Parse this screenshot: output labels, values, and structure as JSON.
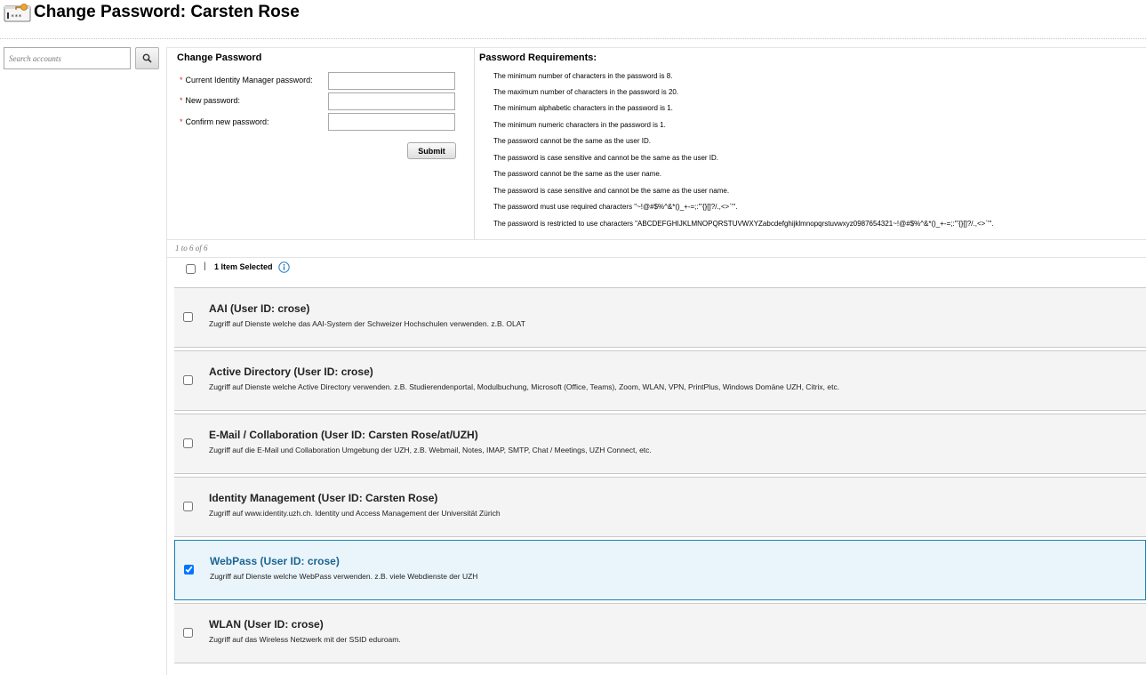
{
  "header": {
    "title": "Change Password: Carsten Rose",
    "icon_name": "password-key-icon"
  },
  "search": {
    "placeholder": "Search accounts",
    "icon_name": "magnifier-icon"
  },
  "change_password": {
    "title": "Change Password",
    "required_marker": "*",
    "fields": [
      {
        "label": "Current Identity Manager password:",
        "value": ""
      },
      {
        "label": "New password:",
        "value": ""
      },
      {
        "label": "Confirm new password:",
        "value": ""
      }
    ],
    "submit_label": "Submit"
  },
  "requirements": {
    "title": "Password Requirements:",
    "items": [
      "The minimum number of characters in the password is 8.",
      "The maximum number of characters in the password is 20.",
      "The minimum alphabetic characters in the password is 1.",
      "The minimum numeric characters in the password is 1.",
      "The password cannot be the same as the user ID.",
      "The password is case sensitive and cannot be the same as the user ID.",
      "The password cannot be the same as the user name.",
      "The password is case sensitive and cannot be the same as the user name.",
      "The password must use required characters \"~!@#$%^&*()_+-=;:'\"{}[]?/.,<>`'\".",
      "The password is restricted to use characters \"ABCDEFGHIJKLMNOPQRSTUVWXYZabcdefghijklmnopqrstuvwxyz0987654321~!@#$%^&*()_+-=;:'\"{}[]?/.,<>`'\"."
    ]
  },
  "results": {
    "count_text": "1 to 6 of 6",
    "separator": "|",
    "selected_text": "1 Item Selected"
  },
  "accounts": [
    {
      "title": "AAI (User ID: crose)",
      "description": "Zugriff auf Dienste welche das AAI-System der Schweizer Hochschulen verwenden. z.B. OLAT",
      "checked": false
    },
    {
      "title": "Active Directory (User ID: crose)",
      "description": "Zugriff auf Dienste welche Active Directory verwenden. z.B. Studierendenportal, Modulbuchung, Microsoft (Office, Teams), Zoom, WLAN, VPN, PrintPlus, Windows Domäne UZH, Citrix, etc.",
      "checked": false
    },
    {
      "title": "E-Mail / Collaboration (User ID: Carsten Rose/at/UZH)",
      "description": "Zugriff auf die E-Mail und Collaboration Umgebung der UZH, z.B. Webmail, Notes, IMAP, SMTP, Chat / Meetings, UZH Connect, etc.",
      "checked": false
    },
    {
      "title": "Identity Management (User ID: Carsten Rose)",
      "description": "Zugriff auf www.identity.uzh.ch. Identity und Access Management der Universität Zürich",
      "checked": false
    },
    {
      "title": "WebPass (User ID: crose)",
      "description": "Zugriff auf Dienste welche WebPass verwenden. z.B. viele Webdienste der UZH",
      "checked": true
    },
    {
      "title": "WLAN (User ID: crose)",
      "description": "Zugriff auf das Wireless Netzwerk mit der SSID eduroam.",
      "checked": false
    }
  ],
  "colors": {
    "selected_border": "#1d7fb4",
    "selected_title": "#1a6592",
    "required_star": "#c0392b"
  }
}
